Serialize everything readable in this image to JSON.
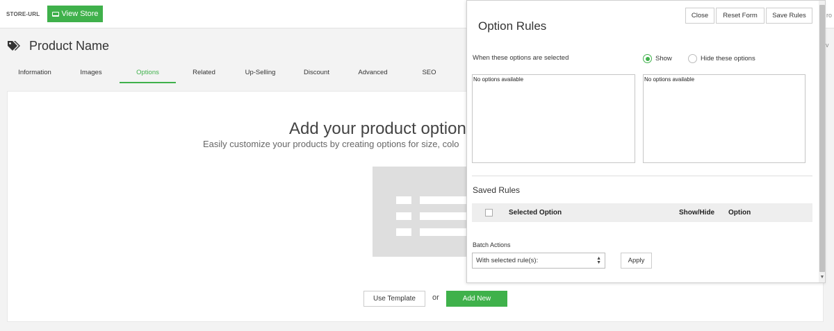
{
  "topbar": {
    "store_url": "STORE-URL",
    "view_store": "View Store"
  },
  "product": {
    "name": "Product Name"
  },
  "tabs": [
    {
      "label": "Information"
    },
    {
      "label": "Images"
    },
    {
      "label": "Options",
      "active": true
    },
    {
      "label": "Related"
    },
    {
      "label": "Up-Selling"
    },
    {
      "label": "Discount"
    },
    {
      "label": "Advanced"
    },
    {
      "label": "SEO"
    }
  ],
  "options_empty": {
    "title": "Add your product option",
    "subtitle": "Easily customize your products by creating options for size, colo",
    "use_template": "Use Template",
    "or": "or",
    "add_new": "Add New"
  },
  "background_edge": {
    "text1": "ro",
    "text2": "v"
  },
  "modal": {
    "title": "Option Rules",
    "close": "Close",
    "reset_form": "Reset Form",
    "save_rules": "Save Rules",
    "when_label": "When these options are selected",
    "show_label": "Show",
    "show_checked": true,
    "hide_label": "Hide these options",
    "left_list_text": "No options available",
    "right_list_text": "No options available",
    "saved_rules_title": "Saved Rules",
    "columns": {
      "selected_option": "Selected Option",
      "show_hide": "Show/Hide",
      "option": "Option"
    },
    "batch_actions_label": "Batch Actions",
    "batch_select_value": "With selected rule(s):",
    "apply": "Apply"
  },
  "colors": {
    "accent": "#3fb14b"
  }
}
